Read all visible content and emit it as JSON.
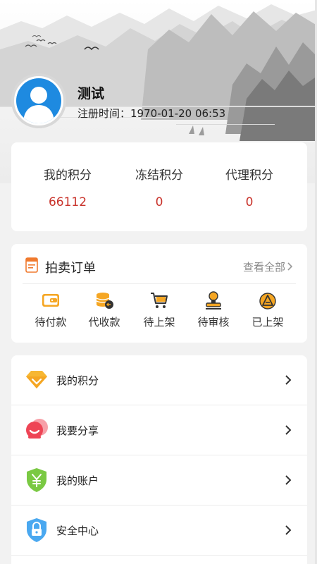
{
  "profile": {
    "username": "测试",
    "registration_label": "注册时间：",
    "registration_time": "1970-01-20 06:53"
  },
  "points": {
    "items": [
      {
        "label": "我的积分",
        "value": "66112"
      },
      {
        "label": "冻结积分",
        "value": "0"
      },
      {
        "label": "代理积分",
        "value": "0"
      }
    ]
  },
  "orders": {
    "title": "拍卖订单",
    "view_all": "查看全部",
    "items": [
      {
        "label": "待付款",
        "icon": "wallet-icon"
      },
      {
        "label": "代收款",
        "icon": "coin-stack-icon"
      },
      {
        "label": "待上架",
        "icon": "cart-icon"
      },
      {
        "label": "待审核",
        "icon": "stamp-icon"
      },
      {
        "label": "已上架",
        "icon": "shelf-up-icon"
      }
    ]
  },
  "menu": {
    "items": [
      {
        "label": "我的积分",
        "icon": "diamond-icon"
      },
      {
        "label": "我要分享",
        "icon": "share-icon"
      },
      {
        "label": "我的账户",
        "icon": "account-shield-icon"
      },
      {
        "label": "安全中心",
        "icon": "security-lock-icon"
      }
    ]
  },
  "colors": {
    "value_red": "#c9332b",
    "accent_orange": "#f5a623",
    "avatar_blue": "#1e8ae0"
  }
}
